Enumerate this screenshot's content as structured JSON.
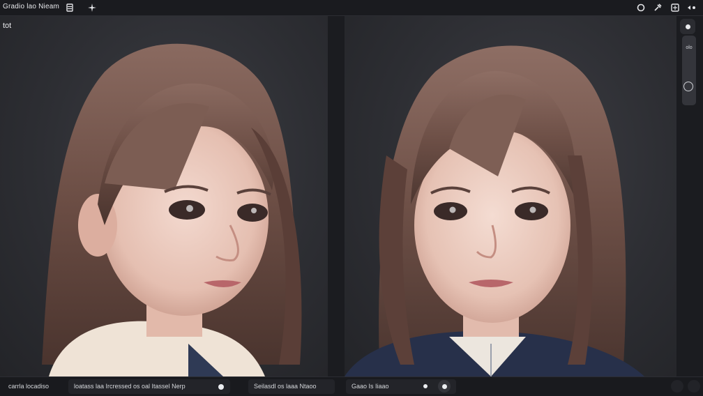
{
  "app": {
    "title": "Gradio lao Nieam"
  },
  "toolbar": {
    "left_icons": [
      "list-icon",
      "sparkle-icon"
    ],
    "right_icons": [
      "circle-icon",
      "tool-icon",
      "window-icon",
      "more-icon"
    ]
  },
  "left_panel": {
    "label": "tot"
  },
  "bottom_bar": {
    "status_left": "carrla locadiso",
    "status_mid": "loatass laa Ircressed os oal Itassel Nerp",
    "status_mid2": "Seilasdl os laaa Ntaoo",
    "status_right": "Gaao Is Iiaao"
  },
  "rail": {
    "sub_label": "olo"
  },
  "colors": {
    "background": "#1e1f23",
    "panel": "#2d2e33",
    "hair": "#6b4d44",
    "accent": "#eceef1"
  }
}
